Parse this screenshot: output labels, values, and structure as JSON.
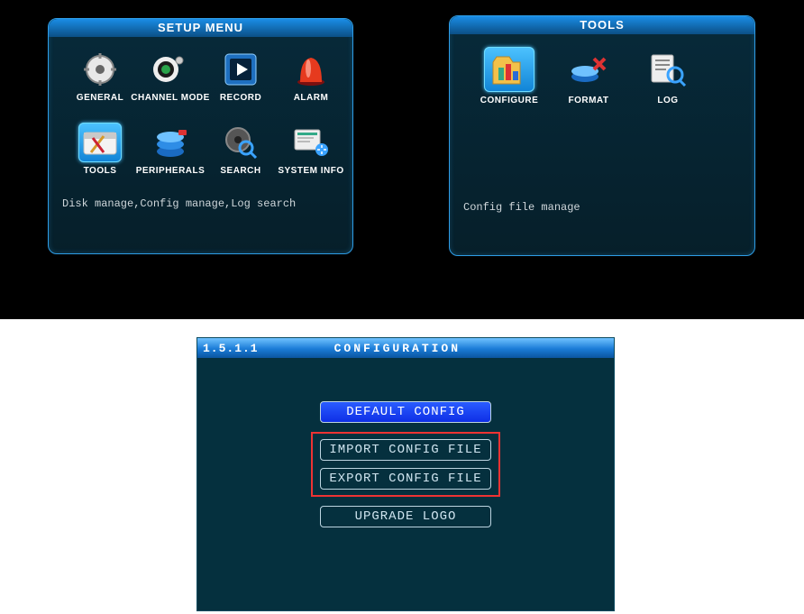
{
  "setup_menu": {
    "title": "SETUP MENU",
    "items": [
      {
        "id": "general",
        "label": "GENERAL"
      },
      {
        "id": "channel-mode",
        "label": "CHANNEL MODE"
      },
      {
        "id": "record",
        "label": "RECORD"
      },
      {
        "id": "alarm",
        "label": "ALARM"
      },
      {
        "id": "tools",
        "label": "TOOLS",
        "selected": true
      },
      {
        "id": "peripherals",
        "label": "PERIPHERALS"
      },
      {
        "id": "search",
        "label": "SEARCH"
      },
      {
        "id": "system-info",
        "label": "SYSTEM INFO"
      }
    ],
    "description": "Disk manage,Config manage,Log search"
  },
  "tools_panel": {
    "title": "TOOLS",
    "items": [
      {
        "id": "configure",
        "label": "CONFIGURE",
        "selected": true
      },
      {
        "id": "format",
        "label": "FORMAT"
      },
      {
        "id": "log",
        "label": "LOG"
      }
    ],
    "description": "Config file manage"
  },
  "config_window": {
    "version": "1.5.1.1",
    "title": "CONFIGURATION",
    "buttons": {
      "default": "DEFAULT CONFIG",
      "import": "IMPORT CONFIG FILE",
      "export": "EXPORT CONFIG FILE",
      "upgrade": "UPGRADE LOGO"
    }
  }
}
